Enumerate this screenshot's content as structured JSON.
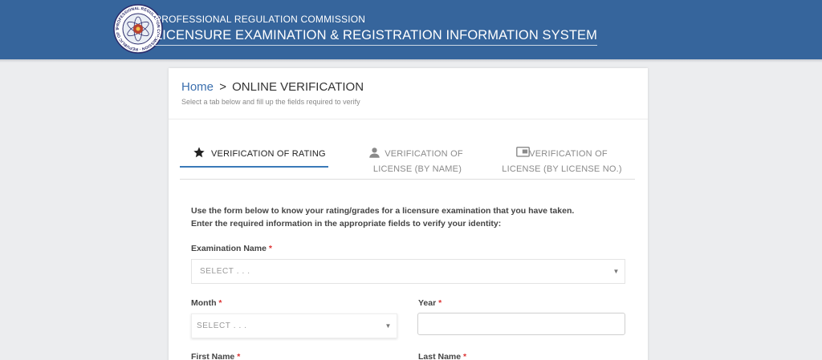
{
  "header": {
    "org_name": "PROFESSIONAL REGULATION COMMISSION",
    "system_name": "LICENSURE EXAMINATION & REGISTRATION INFORMATION SYSTEM",
    "logo_icon": "prc-seal-logo",
    "seal_text": "PROFESSIONAL REGULATION COMMISSION · REPUBLIC OF THE PHILIPPINES"
  },
  "breadcrumb": {
    "home": "Home",
    "separator": ">",
    "current": "ONLINE VERIFICATION"
  },
  "subtitle": "Select a tab below and fill up the fields required to verify",
  "tabs": [
    {
      "icon": "star-icon",
      "line1": "VERIFICATION OF RATING",
      "line2": "",
      "active": true
    },
    {
      "icon": "person-icon",
      "line1": "VERIFICATION OF",
      "line2": "LICENSE (BY NAME)",
      "active": false
    },
    {
      "icon": "id-card-icon",
      "line1": "VERIFICATION OF",
      "line2": "LICENSE (BY LICENSE NO.)",
      "active": false
    }
  ],
  "intro": {
    "line1": "Use the form below to know your rating/grades for a licensure examination that you have taken.",
    "line2": "Enter the required information in the appropriate fields to verify your identity:"
  },
  "form": {
    "required_mark": "*",
    "exam_name": {
      "label": "Examination Name",
      "value": "SELECT . . ."
    },
    "month": {
      "label": "Month",
      "value": "SELECT . . ."
    },
    "year": {
      "label": "Year",
      "value": ""
    },
    "first_name": {
      "label": "First Name"
    },
    "last_name": {
      "label": "Last Name"
    }
  },
  "colors": {
    "header_bg": "#36659c",
    "accent": "#3a79b8",
    "required": "#dd3333",
    "page_bg": "#ecedef"
  }
}
